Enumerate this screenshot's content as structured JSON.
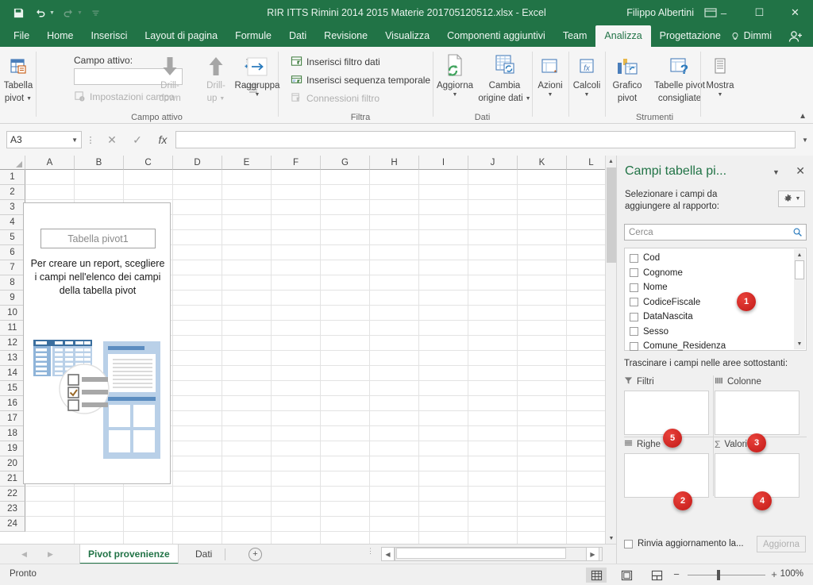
{
  "window": {
    "document_title": "RIR ITTS Rimini 2014 2015 Materie 201705120512.xlsx  -  Excel",
    "user_name": "Filippo Albertini",
    "quick_access": [
      "save-icon",
      "undo-icon",
      "redo-icon",
      "customize-icon"
    ],
    "controls": [
      "ribbon-display-icon",
      "minimize",
      "maximize",
      "close"
    ],
    "minimize_glyph": "–",
    "maximize_glyph": "☐",
    "close_glyph": "✕"
  },
  "ribbon_tabs": [
    {
      "label": "File",
      "active": false
    },
    {
      "label": "Home",
      "active": false
    },
    {
      "label": "Inserisci",
      "active": false
    },
    {
      "label": "Layout di pagina",
      "active": false
    },
    {
      "label": "Formule",
      "active": false
    },
    {
      "label": "Dati",
      "active": false
    },
    {
      "label": "Revisione",
      "active": false
    },
    {
      "label": "Visualizza",
      "active": false
    },
    {
      "label": "Componenti aggiuntivi",
      "active": false
    },
    {
      "label": "Team",
      "active": false
    },
    {
      "label": "Analizza",
      "active": true
    },
    {
      "label": "Progettazione",
      "active": false
    }
  ],
  "tell_me": "Dimmi",
  "ribbon": {
    "groups": [
      {
        "name": "Tabella pivot",
        "label": "Tabella pivot"
      },
      {
        "name": "Campo attivo",
        "label": "Campo attivo"
      },
      {
        "name": "Raggruppa",
        "label": ""
      },
      {
        "name": "Filtra",
        "label": "Filtra"
      },
      {
        "name": "Dati",
        "label": "Dati"
      },
      {
        "name": "Strumenti",
        "label": "Strumenti"
      }
    ],
    "pivot_table_button": "Tabella\npivot",
    "pivot_table_line1": "Tabella",
    "pivot_table_line2": "pivot",
    "active_field_label": "Campo attivo:",
    "active_field_value": "",
    "field_settings": "Impostazioni campo",
    "drill_down_line1": "Drill-",
    "drill_down_line2": "down",
    "drill_up_line1": "Drill-",
    "drill_up_line2": "up",
    "group_button": "Raggruppa",
    "insert_slicer": "Inserisci filtro dati",
    "insert_timeline": "Inserisci sequenza temporale",
    "filter_connections": "Connessioni filtro",
    "refresh": "Aggiorna",
    "change_source_line1": "Cambia",
    "change_source_line2": "origine dati",
    "actions": "Azioni",
    "calculations": "Calcoli",
    "pivot_chart_line1": "Grafico",
    "pivot_chart_line2": "pivot",
    "recommended_line1": "Tabelle pivot",
    "recommended_line2": "consigliate",
    "show": "Mostra"
  },
  "formula_bar": {
    "name_box_value": "A3",
    "cancel_glyph": "✕",
    "enter_glyph": "✓",
    "function_glyph": "fx",
    "formula_value": ""
  },
  "grid": {
    "columns": [
      "A",
      "B",
      "C",
      "D",
      "E",
      "F",
      "G",
      "H",
      "I",
      "J",
      "K",
      "L"
    ],
    "rows": [
      1,
      2,
      3,
      4,
      5,
      6,
      7,
      8,
      9,
      10,
      11,
      12,
      13,
      14,
      15,
      16,
      17,
      18,
      19,
      20,
      21,
      22,
      23,
      24
    ]
  },
  "pivot_placeholder": {
    "title": "Tabella pivot1",
    "message": "Per creare un report, scegliere i campi nell'elenco dei campi della tabella pivot"
  },
  "sheet_tabs": [
    {
      "label": "Pivot provenienze",
      "active": true
    },
    {
      "label": "Dati",
      "active": false
    }
  ],
  "add_sheet_glyph": "+",
  "status_bar": {
    "status_text": "Pronto",
    "zoom_percent": "100%",
    "zoom_out_glyph": "−",
    "zoom_in_glyph": "+",
    "views": [
      "normal-view-icon",
      "page-layout-view-icon",
      "page-break-view-icon"
    ]
  },
  "field_pane": {
    "title": "Campi tabella pi...",
    "subtitle": "Selezionare i campi da aggiungere al rapporto:",
    "search_placeholder": "Cerca",
    "fields": [
      {
        "label": "Cod",
        "checked": false
      },
      {
        "label": "Cognome",
        "checked": false
      },
      {
        "label": "Nome",
        "checked": false
      },
      {
        "label": "CodiceFiscale",
        "checked": false
      },
      {
        "label": "DataNascita",
        "checked": false
      },
      {
        "label": "Sesso",
        "checked": false
      },
      {
        "label": "Comune_Residenza",
        "checked": false
      }
    ],
    "drag_label": "Trascinare i campi nelle aree sottostanti:",
    "zones": [
      {
        "name": "filters",
        "label": "Filtri",
        "icon": "filter-icon",
        "badge": "5"
      },
      {
        "name": "columns",
        "label": "Colonne",
        "icon": "columns-icon",
        "badge": "3"
      },
      {
        "name": "rows",
        "label": "Righe",
        "icon": "rows-icon",
        "badge": "2"
      },
      {
        "name": "values",
        "label": "Valori",
        "icon": "sigma-icon",
        "badge": "4"
      }
    ],
    "defer_label": "Rinvia aggiornamento la...",
    "update_button": "Aggiorna",
    "field_list_badge": "1"
  },
  "colors": {
    "excel_green": "#217346",
    "accent_blue": "#2a7bbd",
    "badge_red": "#c21a18"
  }
}
